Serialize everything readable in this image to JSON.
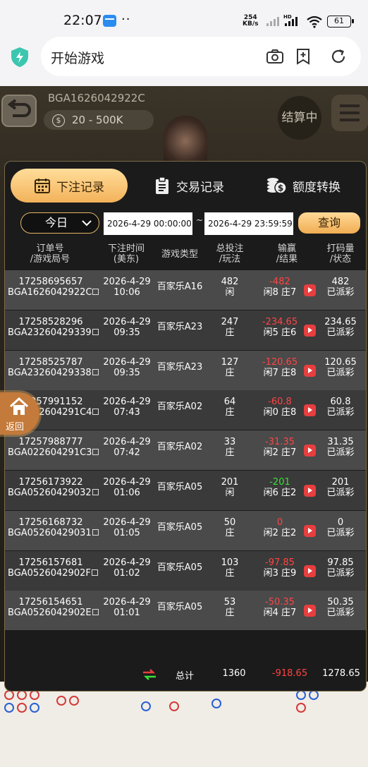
{
  "status_bar": {
    "time": "22:07",
    "dots": "··",
    "speed_value": "254",
    "speed_unit": "KB/s",
    "hd": "HD",
    "battery": "61"
  },
  "browser": {
    "title": "开始游戏",
    "icons": [
      "shield-icon",
      "camera-icon",
      "add-tab-icon",
      "refresh-icon"
    ]
  },
  "game": {
    "table_id": "BGA1626042922C",
    "limit": "20 - 500K",
    "settle_label": "结算中"
  },
  "tabs": [
    {
      "label": "下注记录",
      "icon": "calendar-icon",
      "active": true
    },
    {
      "label": "交易记录",
      "icon": "clipboard-icon",
      "active": false
    },
    {
      "label": "额度转换",
      "icon": "coins-icon",
      "active": false
    }
  ],
  "filter": {
    "day": "今日",
    "start": "2026-4-29 00:00:00",
    "separator": "~",
    "end": "2026-4-29 23:59:59",
    "query_label": "查询"
  },
  "columns": [
    {
      "line1": "订单号",
      "line2": "/游戏局号"
    },
    {
      "line1": "下注时间",
      "line2": "(美东)"
    },
    {
      "line1": "游戏类型",
      "line2": ""
    },
    {
      "line1": "总投注",
      "line2": "/玩法"
    },
    {
      "line1": "输赢",
      "line2": "/结果"
    },
    {
      "line1": "打码量",
      "line2": "/状态"
    }
  ],
  "rows": [
    {
      "order": "17258695657",
      "round": "BGA1626042922C",
      "date": "2026-4-29",
      "time": "10:06",
      "game": "百家乐A16",
      "bet": "482",
      "play": "闲",
      "win": "-482",
      "win_color": "red",
      "result": "闲8 庄7",
      "turnover": "482",
      "status": "已派彩"
    },
    {
      "order": "17258528296",
      "round": "BGA23260429339",
      "date": "2026-4-29",
      "time": "09:35",
      "game": "百家乐A23",
      "bet": "247",
      "play": "庄",
      "win": "-234.65",
      "win_color": "red",
      "result": "闲5 庄6",
      "turnover": "234.65",
      "status": "已派彩"
    },
    {
      "order": "17258525787",
      "round": "BGA23260429338",
      "date": "2026-4-29",
      "time": "09:35",
      "game": "百家乐A23",
      "bet": "127",
      "play": "庄",
      "win": "-120.65",
      "win_color": "red",
      "result": "闲7 庄8",
      "turnover": "120.65",
      "status": "已派彩"
    },
    {
      "order": "17257991152",
      "round": "BGA022604291C4",
      "date": "2026-4-29",
      "time": "07:43",
      "game": "百家乐A02",
      "bet": "64",
      "play": "庄",
      "win": "-60.8",
      "win_color": "red",
      "result": "闲0 庄8",
      "turnover": "60.8",
      "status": "已派彩"
    },
    {
      "order": "17257988777",
      "round": "BGA022604291C3",
      "date": "2026-4-29",
      "time": "07:42",
      "game": "百家乐A02",
      "bet": "33",
      "play": "庄",
      "win": "-31.35",
      "win_color": "red",
      "result": "闲2 庄7",
      "turnover": "31.35",
      "status": "已派彩"
    },
    {
      "order": "17256173922",
      "round": "BGA05260429032",
      "date": "2026-4-29",
      "time": "01:06",
      "game": "百家乐A05",
      "bet": "201",
      "play": "闲",
      "win": "-201",
      "win_color": "green",
      "result": "闲6 庄2",
      "turnover": "201",
      "status": "已派彩"
    },
    {
      "order": "17256168732",
      "round": "BGA05260429031",
      "date": "2026-4-29",
      "time": "01:05",
      "game": "百家乐A05",
      "bet": "50",
      "play": "庄",
      "win": "0",
      "win_color": "red",
      "result": "闲2 庄2",
      "turnover": "0",
      "status": "已派彩"
    },
    {
      "order": "17256157681",
      "round": "BGA0526042902F",
      "date": "2026-4-29",
      "time": "01:02",
      "game": "百家乐A05",
      "bet": "103",
      "play": "庄",
      "win": "-97.85",
      "win_color": "red",
      "result": "闲3 庄9",
      "turnover": "97.85",
      "status": "已派彩"
    },
    {
      "order": "17256154651",
      "round": "BGA0526042902E",
      "date": "2026-4-29",
      "time": "01:01",
      "game": "百家乐A05",
      "bet": "53",
      "play": "庄",
      "win": "-50.35",
      "win_color": "red",
      "result": "闲4 庄7",
      "turnover": "50.35",
      "status": "已派彩"
    }
  ],
  "totals": {
    "label": "总计",
    "bet": "1360",
    "win": "-918.65",
    "turnover": "1278.65"
  },
  "home_float": {
    "label": "返回"
  },
  "colors": {
    "accent": "#f3b25a",
    "loss": "#ff4444",
    "win": "#3adf3a",
    "modal_bg": "#1b1b1b"
  }
}
